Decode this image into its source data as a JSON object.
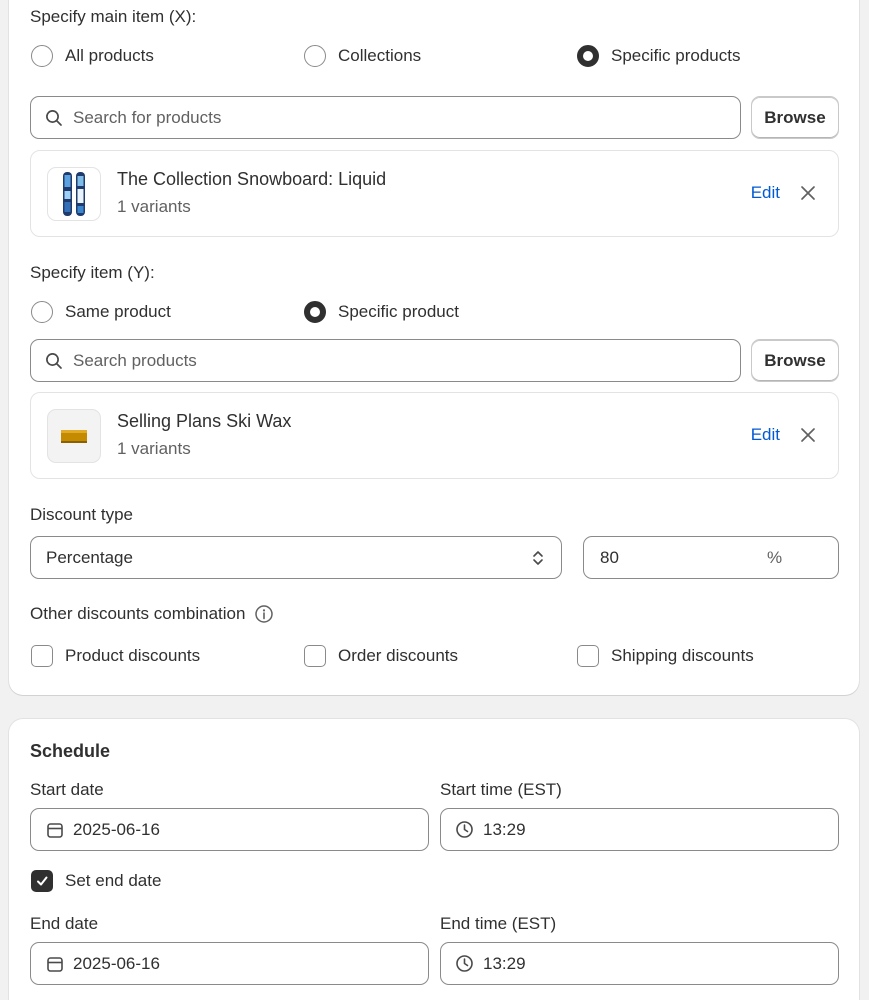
{
  "main_item": {
    "label": "Specify main item (X):",
    "options": [
      "All products",
      "Collections",
      "Specific products"
    ],
    "selected": "Specific products",
    "search_placeholder": "Search for products",
    "browse_label": "Browse",
    "product": {
      "title": "The Collection Snowboard: Liquid",
      "variants": "1 variants",
      "edit_label": "Edit"
    }
  },
  "item_y": {
    "label": "Specify item (Y):",
    "options": [
      "Same product",
      "Specific product"
    ],
    "selected": "Specific product",
    "search_placeholder": "Search products",
    "browse_label": "Browse",
    "product": {
      "title": "Selling Plans Ski Wax",
      "variants": "1 variants",
      "edit_label": "Edit"
    }
  },
  "discount": {
    "type_label": "Discount type",
    "type_value": "Percentage",
    "amount_value": "80",
    "amount_suffix": "%"
  },
  "combination": {
    "label": "Other discounts combination",
    "options": [
      "Product discounts",
      "Order discounts",
      "Shipping discounts"
    ]
  },
  "schedule": {
    "title": "Schedule",
    "start_date_label": "Start date",
    "start_date": "2025-06-16",
    "start_time_label": "Start time (EST)",
    "start_time": "13:29",
    "set_end_date_label": "Set end date",
    "set_end_date_checked": true,
    "end_date_label": "End date",
    "end_date": "2025-06-16",
    "end_time_label": "End time (EST)",
    "end_time": "13:29"
  },
  "colors": {
    "link": "#005bd3",
    "text": "#303030",
    "border": "#8a8a8a"
  }
}
